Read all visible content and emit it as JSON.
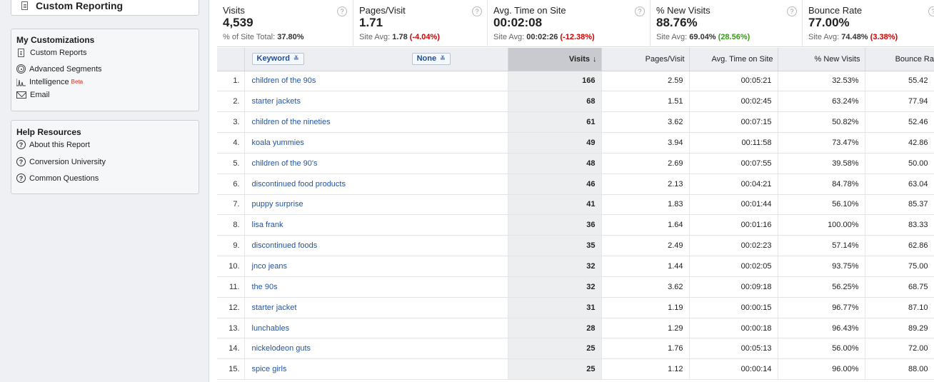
{
  "sidebar": {
    "top_item": "Custom Reporting",
    "customizations": {
      "title": "My Customizations",
      "items": [
        {
          "label": "Custom Reports",
          "icon": "report-icon"
        },
        {
          "label": "Advanced Segments",
          "icon": "segments-icon"
        },
        {
          "label": "Intelligence",
          "badge": "Beta",
          "icon": "intelligence-icon"
        },
        {
          "label": "Email",
          "icon": "email-icon"
        }
      ]
    },
    "help": {
      "title": "Help Resources",
      "items": [
        {
          "label": "About this Report",
          "icon": "help-icon"
        },
        {
          "label": "Conversion University",
          "icon": "help-icon"
        },
        {
          "label": "Common Questions",
          "icon": "help-icon"
        }
      ]
    }
  },
  "summary": [
    {
      "name": "Visits",
      "value": "4,539",
      "sub_label": "% of Site Total: ",
      "sub_value": "37.80%",
      "delta": ""
    },
    {
      "name": "Pages/Visit",
      "value": "1.71",
      "sub_label": "Site Avg: ",
      "sub_value": "1.78",
      "delta": "(-4.04%)",
      "delta_type": "neg"
    },
    {
      "name": "Avg. Time on Site",
      "value": "00:02:08",
      "sub_label": "Site Avg: ",
      "sub_value": "00:02:26",
      "delta": "(-12.38%)",
      "delta_type": "neg"
    },
    {
      "name": "% New Visits",
      "value": "88.76%",
      "sub_label": "Site Avg: ",
      "sub_value": "69.04%",
      "delta": "(28.56%)",
      "delta_type": "pos"
    },
    {
      "name": "Bounce Rate",
      "value": "77.00%",
      "sub_label": "Site Avg: ",
      "sub_value": "74.48%",
      "delta": "(3.38%)",
      "delta_type": "neg"
    }
  ],
  "table": {
    "dimension_label": "Keyword",
    "secondary_label": "None",
    "columns": [
      "Visits",
      "Pages/Visit",
      "Avg. Time on Site",
      "% New Visits",
      "Bounce Ra"
    ],
    "sort_arrow": "↓",
    "rows": [
      {
        "idx": "1.",
        "keyword": "children of the 90s",
        "visits": "166",
        "ppv": "2.59",
        "time": "00:05:21",
        "newv": "32.53%",
        "bounce": "55.42"
      },
      {
        "idx": "2.",
        "keyword": "starter jackets",
        "visits": "68",
        "ppv": "1.51",
        "time": "00:02:45",
        "newv": "63.24%",
        "bounce": "77.94"
      },
      {
        "idx": "3.",
        "keyword": "children of the nineties",
        "visits": "61",
        "ppv": "3.62",
        "time": "00:07:15",
        "newv": "50.82%",
        "bounce": "52.46"
      },
      {
        "idx": "4.",
        "keyword": "koala yummies",
        "visits": "49",
        "ppv": "3.94",
        "time": "00:11:58",
        "newv": "73.47%",
        "bounce": "42.86"
      },
      {
        "idx": "5.",
        "keyword": "children of the 90's",
        "visits": "48",
        "ppv": "2.69",
        "time": "00:07:55",
        "newv": "39.58%",
        "bounce": "50.00"
      },
      {
        "idx": "6.",
        "keyword": "discontinued food products",
        "visits": "46",
        "ppv": "2.13",
        "time": "00:04:21",
        "newv": "84.78%",
        "bounce": "63.04"
      },
      {
        "idx": "7.",
        "keyword": "puppy surprise",
        "visits": "41",
        "ppv": "1.83",
        "time": "00:01:44",
        "newv": "56.10%",
        "bounce": "85.37"
      },
      {
        "idx": "8.",
        "keyword": "lisa frank",
        "visits": "36",
        "ppv": "1.64",
        "time": "00:01:16",
        "newv": "100.00%",
        "bounce": "83.33"
      },
      {
        "idx": "9.",
        "keyword": "discontinued foods",
        "visits": "35",
        "ppv": "2.49",
        "time": "00:02:23",
        "newv": "57.14%",
        "bounce": "62.86"
      },
      {
        "idx": "10.",
        "keyword": "jnco jeans",
        "visits": "32",
        "ppv": "1.44",
        "time": "00:02:05",
        "newv": "93.75%",
        "bounce": "75.00"
      },
      {
        "idx": "11.",
        "keyword": "the 90s",
        "visits": "32",
        "ppv": "3.62",
        "time": "00:09:18",
        "newv": "56.25%",
        "bounce": "68.75"
      },
      {
        "idx": "12.",
        "keyword": "starter jacket",
        "visits": "31",
        "ppv": "1.19",
        "time": "00:00:15",
        "newv": "96.77%",
        "bounce": "87.10"
      },
      {
        "idx": "13.",
        "keyword": "lunchables",
        "visits": "28",
        "ppv": "1.29",
        "time": "00:00:18",
        "newv": "96.43%",
        "bounce": "89.29"
      },
      {
        "idx": "14.",
        "keyword": "nickelodeon guts",
        "visits": "25",
        "ppv": "1.76",
        "time": "00:05:13",
        "newv": "56.00%",
        "bounce": "72.00"
      },
      {
        "idx": "15.",
        "keyword": "spice girls",
        "visits": "25",
        "ppv": "1.12",
        "time": "00:00:14",
        "newv": "96.00%",
        "bounce": "88.00"
      }
    ]
  }
}
